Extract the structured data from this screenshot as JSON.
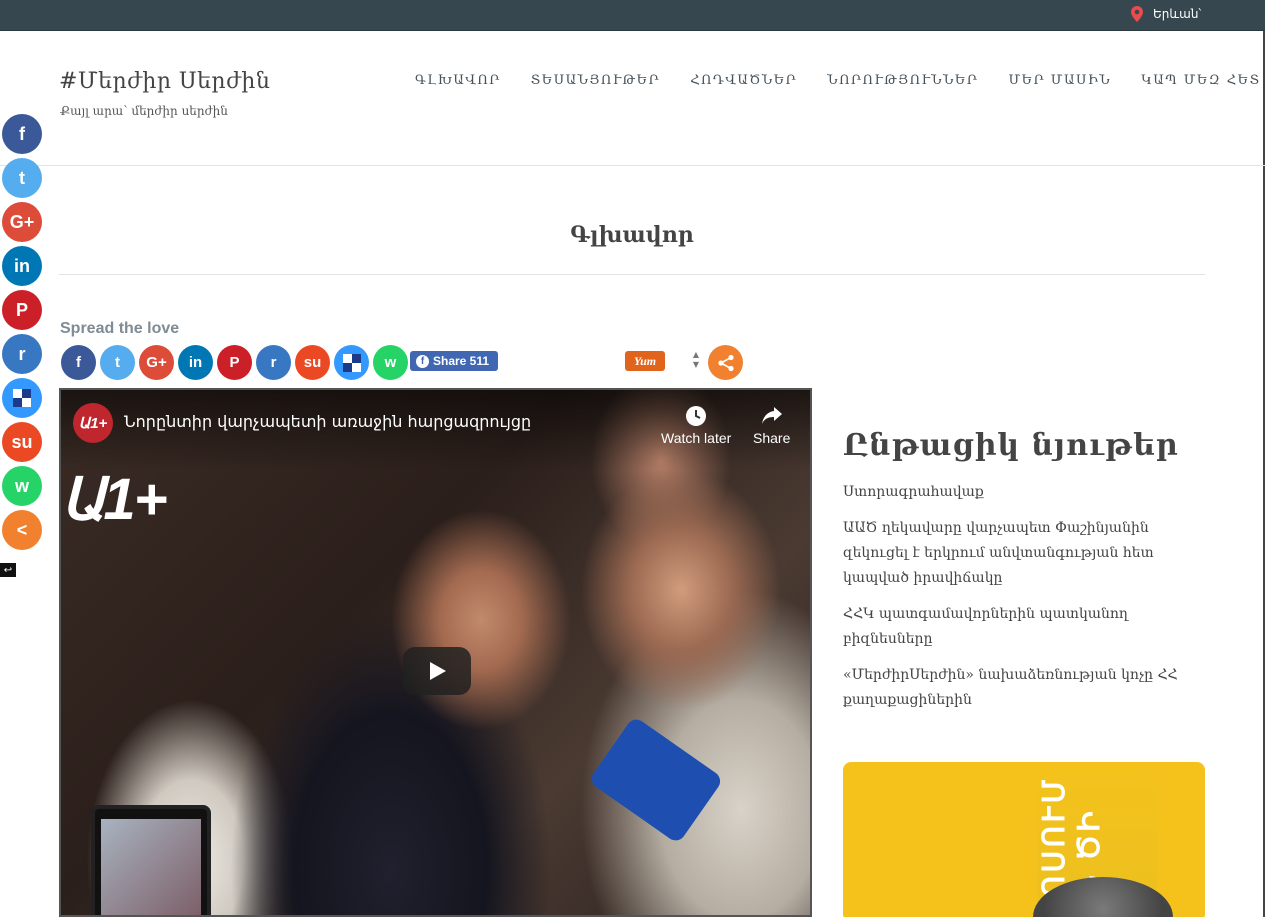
{
  "topbar": {
    "location_icon": "map-pin-icon",
    "location": "Երևան՝"
  },
  "header": {
    "site_title": "#Մերժիր Սերժին",
    "tagline": "Քայլ արա՝ մերժիր սերժին",
    "nav": [
      {
        "label": "ԳԼԽԱՎՈՐ"
      },
      {
        "label": "ՏԵՍԱՆՅՈՒԹԵՐ"
      },
      {
        "label": "ՀՈԴՎԱԾՆԵՐ"
      },
      {
        "label": "ՆՈՐՈՒԹՅՈՒՆՆԵՐ"
      },
      {
        "label": "ՄԵՐ ՄԱՍԻՆ"
      },
      {
        "label": "ԿԱՊ ՄԵԶ ՀԵՏ"
      }
    ]
  },
  "floating_share": [
    {
      "icon": "facebook-icon",
      "glyph": "f",
      "color": "#3b5998"
    },
    {
      "icon": "twitter-icon",
      "glyph": "t",
      "color": "#55acee"
    },
    {
      "icon": "google-plus-icon",
      "glyph": "G+",
      "color": "#dd4b39"
    },
    {
      "icon": "linkedin-icon",
      "glyph": "in",
      "color": "#0077b5"
    },
    {
      "icon": "pinterest-icon",
      "glyph": "P",
      "color": "#cb2027"
    },
    {
      "icon": "reddit-icon",
      "glyph": "r",
      "color": "#3877c1"
    },
    {
      "icon": "delicious-icon",
      "glyph": "",
      "color": "#3399ff"
    },
    {
      "icon": "stumbleupon-icon",
      "glyph": "su",
      "color": "#eb4924"
    },
    {
      "icon": "whatsapp-icon",
      "glyph": "w",
      "color": "#25d366"
    },
    {
      "icon": "share-icon",
      "glyph": "<",
      "color": "#f1812e"
    }
  ],
  "page": {
    "title": "Գլխավոր"
  },
  "share_section": {
    "heading": "Spread the love",
    "icons": [
      {
        "icon": "facebook-icon",
        "glyph": "f",
        "color": "#3b5998"
      },
      {
        "icon": "twitter-icon",
        "glyph": "t",
        "color": "#55acee"
      },
      {
        "icon": "google-plus-icon",
        "glyph": "G+",
        "color": "#dd4b39"
      },
      {
        "icon": "linkedin-icon",
        "glyph": "in",
        "color": "#0077b5"
      },
      {
        "icon": "pinterest-icon",
        "glyph": "P",
        "color": "#cb2027"
      },
      {
        "icon": "reddit-icon",
        "glyph": "r",
        "color": "#3877c1"
      },
      {
        "icon": "stumbleupon-icon",
        "glyph": "su",
        "color": "#eb4924"
      },
      {
        "icon": "delicious-icon",
        "glyph": "",
        "color": "#3399ff"
      },
      {
        "icon": "whatsapp-icon",
        "glyph": "w",
        "color": "#25d366"
      }
    ],
    "fb_share_label": "Share 511",
    "yum_label": "Yum"
  },
  "video": {
    "channel_logo": "Ա1+",
    "title": "Նորընտիր վարչապետի առաջին հարցազրույցը",
    "watermark": "Ա1+",
    "watch_later": "Watch later",
    "share": "Share"
  },
  "sidebar": {
    "heading": "Ընթացիկ նյութեր",
    "items": [
      {
        "text": "Ստորագրահավաք"
      },
      {
        "text": "ԱԱԾ ղեկավարը վարչապետ Փաշինյանին զեկուցել է երկրում անվտանգության հետ կապված իրավիճակը"
      },
      {
        "text": "ՀՀԿ պատգամավորներին պատկանող բիզնեսները"
      },
      {
        "text": "«ՄերժիրՍերժին» նախաձեռնության կոչը ՀՀ քաղաքացիներին"
      }
    ],
    "poster_text": "ՀՈՍՈՒՄ ԵՆ ԾԻ"
  },
  "colors": {
    "topbar": "#37474f",
    "accent_orange": "#f1812e",
    "fb_blue": "#4267b2"
  }
}
